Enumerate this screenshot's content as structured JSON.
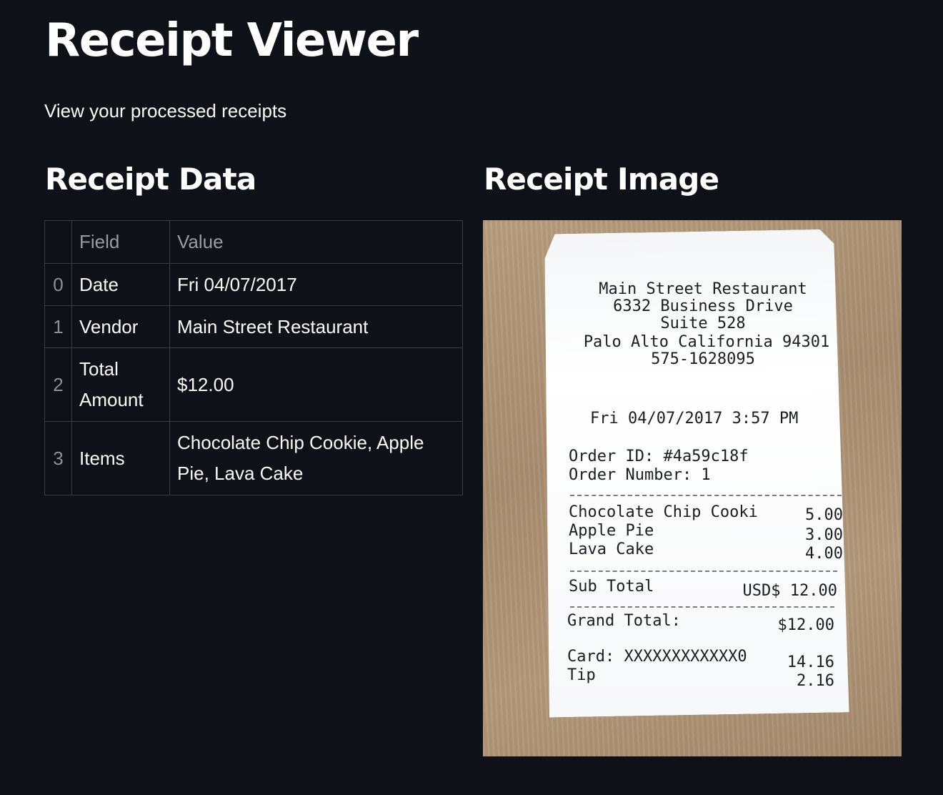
{
  "header": {
    "title": "Receipt Viewer",
    "subtitle": "View your processed receipts"
  },
  "left_column": {
    "heading": "Receipt Data",
    "table": {
      "columns": [
        "",
        "Field",
        "Value"
      ],
      "rows": [
        {
          "index": "0",
          "field": "Date",
          "value": "Fri 04/07/2017"
        },
        {
          "index": "1",
          "field": "Vendor",
          "value": "Main Street Restaurant"
        },
        {
          "index": "2",
          "field": "Total Amount",
          "value": "$12.00"
        },
        {
          "index": "3",
          "field": "Items",
          "value": "Chocolate Chip Cookie, Apple Pie, Lava Cake"
        }
      ]
    }
  },
  "right_column": {
    "heading": "Receipt Image",
    "receipt": {
      "vendor": "Main Street Restaurant",
      "address1": "6332 Business Drive",
      "address2": "Suite 528",
      "address3": "Palo Alto California 94301",
      "phone": "575-1628095",
      "datetime": "Fri 04/07/2017 3:57 PM",
      "order_id": "Order ID: #4a59c18f",
      "order_number": "Order Number: 1",
      "items": [
        {
          "name": "Chocolate Chip Cooki",
          "price": "5.00"
        },
        {
          "name": "Apple Pie",
          "price": "3.00"
        },
        {
          "name": "Lava Cake",
          "price": "4.00"
        }
      ],
      "subtotal_label": "Sub Total",
      "subtotal_value": "USD$ 12.00",
      "grand_total_label": "Grand Total:",
      "grand_total_value": "$12.00",
      "card_label": "Card: XXXXXXXXXXXX0",
      "card_value": "14.16",
      "tip_label": "Tip",
      "tip_value": "2.16"
    }
  }
}
